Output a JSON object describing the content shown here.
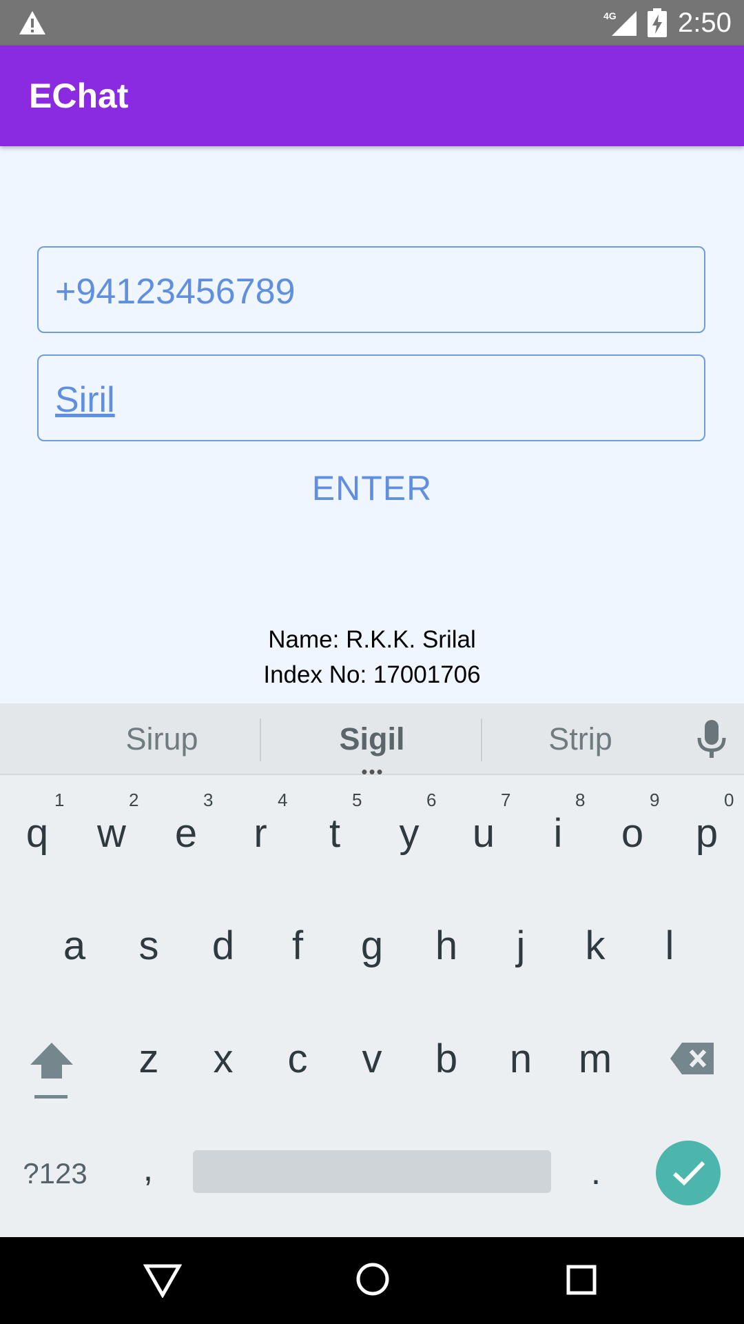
{
  "status_bar": {
    "time": "2:50",
    "network": "4G",
    "warning_icon": "warning-icon",
    "battery_icon": "battery-charging-icon"
  },
  "app_bar": {
    "title": "EChat"
  },
  "form": {
    "phone_value": "+94123456789",
    "name_value": "Siril",
    "enter_label": "ENTER"
  },
  "footer": {
    "name_line": "Name: R.K.K. Srilal",
    "index_line": "Index No: 17001706"
  },
  "keyboard": {
    "suggestions": [
      "Sirup",
      "Sigil",
      "Strip"
    ],
    "row1": [
      "q",
      "w",
      "e",
      "r",
      "t",
      "y",
      "u",
      "i",
      "o",
      "p"
    ],
    "row1_hints": [
      "1",
      "2",
      "3",
      "4",
      "5",
      "6",
      "7",
      "8",
      "9",
      "0"
    ],
    "row2": [
      "a",
      "s",
      "d",
      "f",
      "g",
      "h",
      "j",
      "k",
      "l"
    ],
    "row3": [
      "z",
      "x",
      "c",
      "v",
      "b",
      "n",
      "m"
    ],
    "symbols_label": "?123",
    "comma_label": ",",
    "period_label": "."
  },
  "colors": {
    "app_bar": "#8a2be2",
    "accent": "#5f8fde",
    "background": "#eff6ff",
    "enter_key": "#4db6ac"
  }
}
